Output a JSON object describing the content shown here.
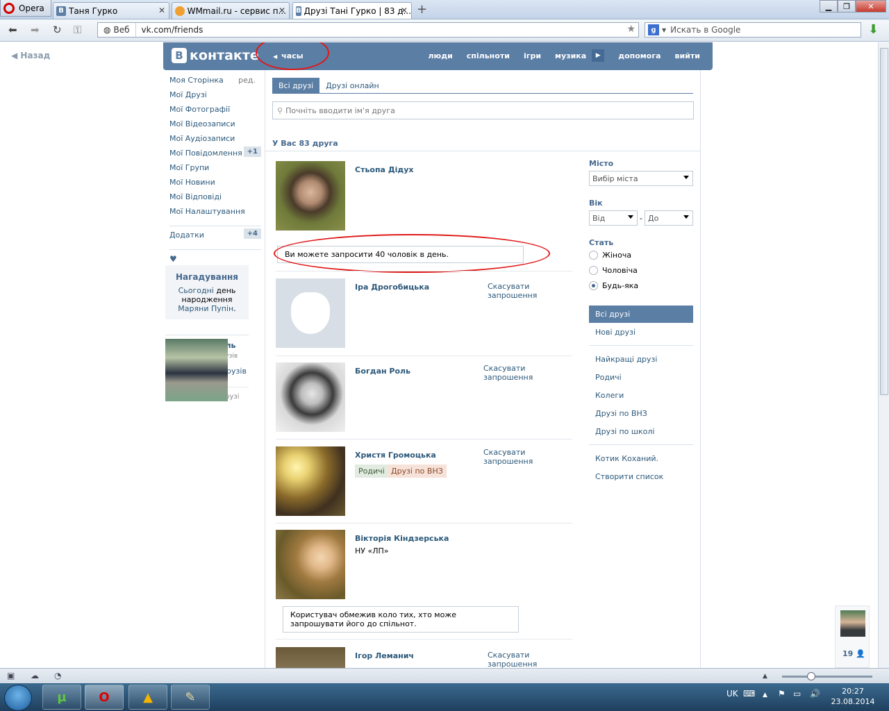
{
  "browser": {
    "menu_label": "Opera",
    "tabs": [
      {
        "label": "Таня Гурко",
        "icon": "vk-favicon"
      },
      {
        "label": "WMmail.ru - сервис п...",
        "icon": "wmmail-favicon"
      },
      {
        "label": "Друзі Тані Гурко | 83 д...",
        "icon": "vk-favicon"
      }
    ],
    "new_tab": "+",
    "address_web": "Веб",
    "url": "vk.com/friends",
    "search_placeholder": "Искать в Google"
  },
  "page": {
    "back_label": "Назад",
    "logo": "контакте",
    "logo_letter": "В",
    "status_label": "часы",
    "top_menu": [
      "люди",
      "спільноти",
      "ігри",
      "музика",
      "допомога",
      "вийти"
    ],
    "left_menu": [
      {
        "label": "Моя Сторінка",
        "extra": "ред."
      },
      {
        "label": "Мої Друзі"
      },
      {
        "label": "Мої Фотографії"
      },
      {
        "label": "Мої Відеозаписи"
      },
      {
        "label": "Мої Аудіозаписи"
      },
      {
        "label": "Мої Повідомлення",
        "badge": "+1"
      },
      {
        "label": "Мої Групи"
      },
      {
        "label": "Мої Новини"
      },
      {
        "label": "Мої Відповіді"
      },
      {
        "label": "Мої Налаштування"
      }
    ],
    "apps": {
      "label": "Додатки",
      "badge": "+4"
    },
    "heart": "♥",
    "reminder": {
      "title": "Нагадування",
      "today": "Сьогодні",
      "text": "день народження",
      "name": "Маряни Пупін",
      "dot": "."
    },
    "suggest": {
      "name": "Роман Смаль",
      "common": "10 спільних друзів",
      "add": "Долучити до друзів",
      "all": "Всі можливі друзі"
    },
    "tabs": [
      "Всі друзі",
      "Друзі онлайн"
    ],
    "search_placeholder": "Почніть вводити ім'я друга",
    "count": "У Вас 83 друга",
    "friends": [
      {
        "name": "Стьопа Дідух"
      },
      {
        "name": "Іра Дрогобицька",
        "action": "Скасувати запрошення"
      },
      {
        "name": "Богдан Роль",
        "action": "Скасувати запрошення"
      },
      {
        "name": "Христя Громоцька",
        "action": "Скасувати запрошення",
        "tags": [
          "Родичі",
          "Друзі по ВНЗ"
        ]
      },
      {
        "name": "Вікторія Кіндзерська",
        "sub": "НУ «ЛП»"
      },
      {
        "name": "Ігор Леманич",
        "action": "Скасувати запрошення"
      }
    ],
    "tip_invite": "Ви можете запросити 40 чоловік в день.",
    "tip_restrict": "Користувач обмежив коло тих, хто може запрошувати його до спільнот.",
    "filters": {
      "city_label": "Місто",
      "city_value": "Вибір міста",
      "age_label": "Вік",
      "age_from": "Від",
      "age_dash": "-",
      "age_to": "До",
      "sex_label": "Стать",
      "sex_options": [
        "Жіноча",
        "Чоловіча",
        "Будь-яка"
      ],
      "sex_selected": "Будь-яка"
    },
    "lists": {
      "primary": [
        "Всі друзі",
        "Нові друзі"
      ],
      "categories": [
        "Найкращі друзі",
        "Родичі",
        "Колеги",
        "Друзі по ВНЗ",
        "Друзі по школі"
      ],
      "custom": [
        "Котик Коханий.",
        "Створити список"
      ]
    },
    "mini_chat_count": "19"
  },
  "taskbar": {
    "lang": "UK",
    "time": "20:27",
    "date": "23.08.2014"
  },
  "colors": {
    "vk_blue": "#5b7ea5",
    "link": "#2b587a",
    "annotation_red": "#e01818"
  }
}
